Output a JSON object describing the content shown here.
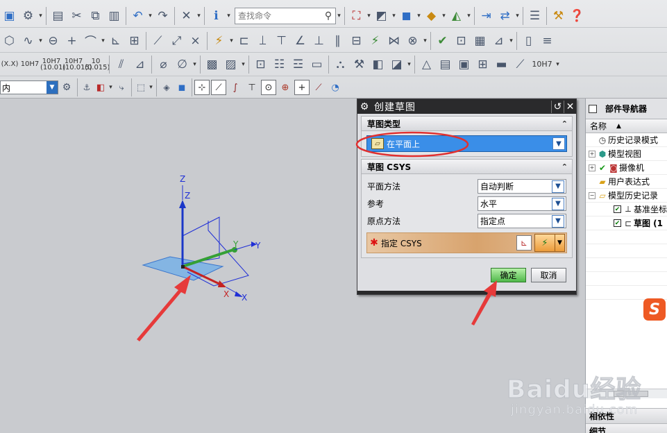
{
  "toolbar": {
    "search_placeholder": "查找命令",
    "tolerance_labels": [
      "(X.X)",
      "10H7",
      "10H7 (10.01)",
      "10H7 (10.015)",
      "10 (0.015)"
    ],
    "tolerance_trailing": "10H7",
    "filter_value": "内"
  },
  "dialog": {
    "title": "创建草图",
    "group_type_label": "草图类型",
    "sketch_type_value": "在平面上",
    "group_csys_label": "草图 CSYS",
    "plane_method_label": "平面方法",
    "plane_method_value": "自动判断",
    "reference_label": "参考",
    "reference_value": "水平",
    "origin_method_label": "原点方法",
    "origin_method_value": "指定点",
    "specify_csys_label": "指定 CSYS",
    "ok_label": "确定",
    "cancel_label": "取消"
  },
  "navigator": {
    "title": "部件导航器",
    "column_name": "名称",
    "items": [
      {
        "label": "历史记录模式"
      },
      {
        "label": "模型视图"
      },
      {
        "label": "摄像机"
      },
      {
        "label": "用户表达式"
      },
      {
        "label": "模型历史记录"
      },
      {
        "label": "基准坐标"
      },
      {
        "label": "草图 (1"
      }
    ],
    "section_dependencies": "相依性",
    "section_details": "细节"
  },
  "viewport": {
    "axis_labels": {
      "z1": "Z",
      "z2": "Z",
      "y1": "Y",
      "y2": "Y",
      "x1": "X",
      "x2": "X"
    }
  },
  "watermark": {
    "logo": "Baidu经验",
    "url": "jingyan.baidu.com"
  },
  "colors": {
    "highlight_red": "#e03030",
    "selection_blue": "#3a8ee8",
    "ok_green": "#4fb84a"
  }
}
